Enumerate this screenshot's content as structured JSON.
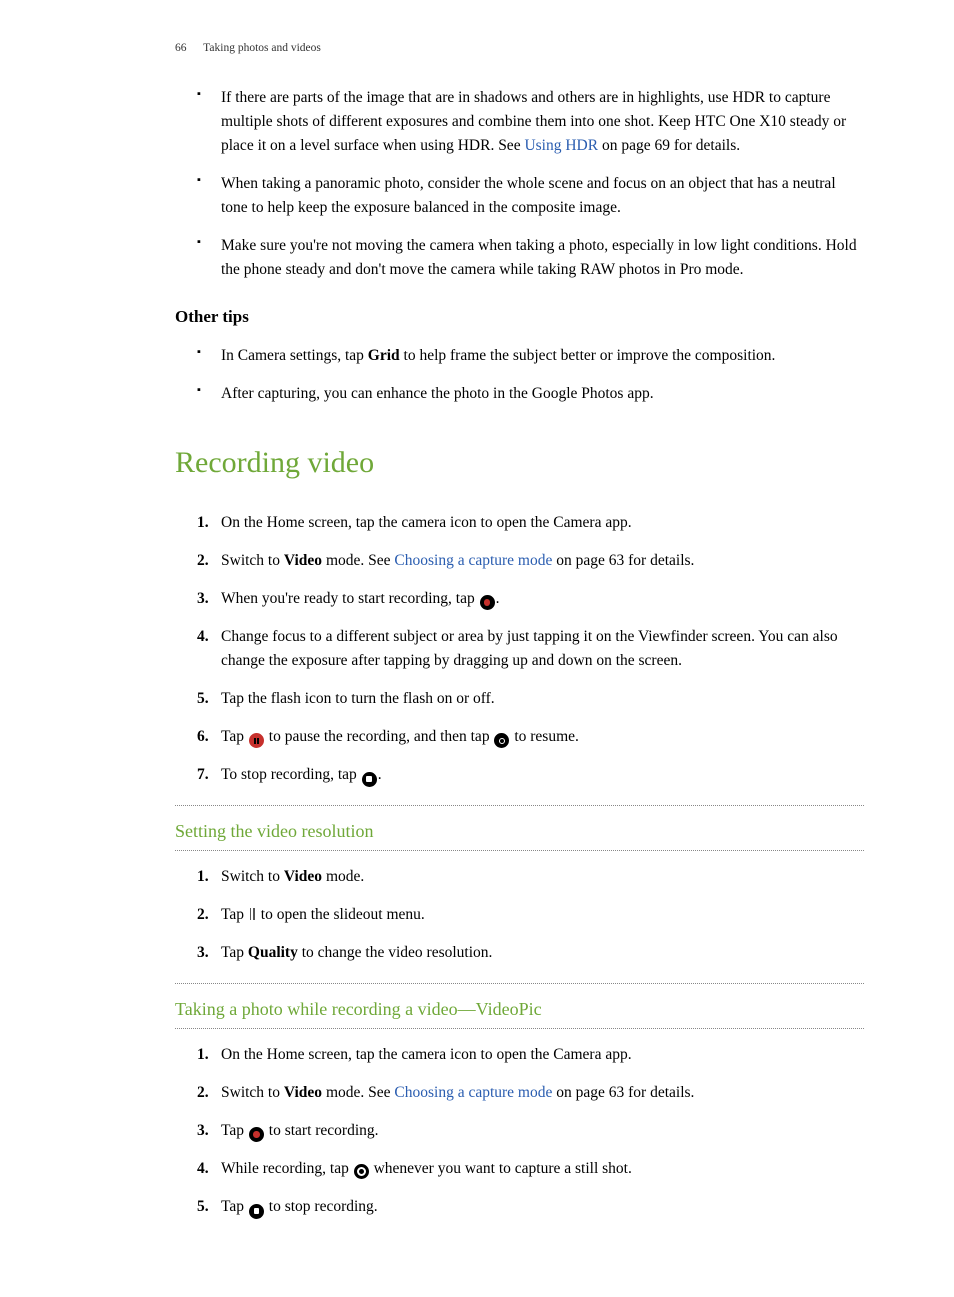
{
  "header": {
    "page": "66",
    "title": "Taking photos and videos"
  },
  "tips_bullets": {
    "b1a": "If there are parts of the image that are in shadows and others are in highlights, use HDR to capture multiple shots of different exposures and combine them into one shot. Keep HTC One X10 steady or place it on a level surface when using HDR. See ",
    "b1link": "Using HDR",
    "b1b": " on page 69 for details.",
    "b2": "When taking a panoramic photo, consider the whole scene and focus on an object that has a neutral tone to help keep the exposure balanced in the composite image.",
    "b3": "Make sure you're not moving the camera when taking a photo, especially in low light conditions. Hold the phone steady and don't move the camera while taking RAW photos in Pro mode."
  },
  "other_tips": {
    "heading": "Other tips",
    "b1a": "In Camera settings, tap ",
    "b1bold": "Grid",
    "b1b": " to help frame the subject better or improve the composition.",
    "b2": "After capturing, you can enhance the photo in the Google Photos app."
  },
  "recording": {
    "title": "Recording video",
    "s1": "On the Home screen, tap the camera icon to open the Camera app.",
    "s2a": "Switch to ",
    "s2bold": "Video",
    "s2b": " mode. See ",
    "s2link": "Choosing a capture mode",
    "s2c": " on page 63 for details.",
    "s3a": "When you're ready to start recording, tap ",
    "s3b": ".",
    "s4": "Change focus to a different subject or area by just tapping it on the Viewfinder screen. You can also change the exposure after tapping by dragging up and down on the screen.",
    "s5": "Tap the flash icon to turn the flash on or off.",
    "s6a": "Tap ",
    "s6b": " to pause the recording, and then tap ",
    "s6c": " to resume.",
    "s7a": "To stop recording, tap ",
    "s7b": "."
  },
  "resolution": {
    "title": "Setting the video resolution",
    "s1a": "Switch to ",
    "s1bold": "Video",
    "s1b": " mode.",
    "s2a": "Tap ",
    "s2b": " to open the slideout menu.",
    "s3a": "Tap ",
    "s3bold": "Quality",
    "s3b": " to change the video resolution."
  },
  "videopic": {
    "title": "Taking a photo while recording a video—VideoPic",
    "s1": "On the Home screen, tap the camera icon to open the Camera app.",
    "s2a": "Switch to ",
    "s2bold": "Video",
    "s2b": " mode. See ",
    "s2link": "Choosing a capture mode",
    "s2c": " on page 63 for details.",
    "s3a": "Tap ",
    "s3b": " to start recording.",
    "s4a": "While recording, tap ",
    "s4b": " whenever you want to capture a still shot.",
    "s5a": "Tap ",
    "s5b": " to stop recording."
  }
}
